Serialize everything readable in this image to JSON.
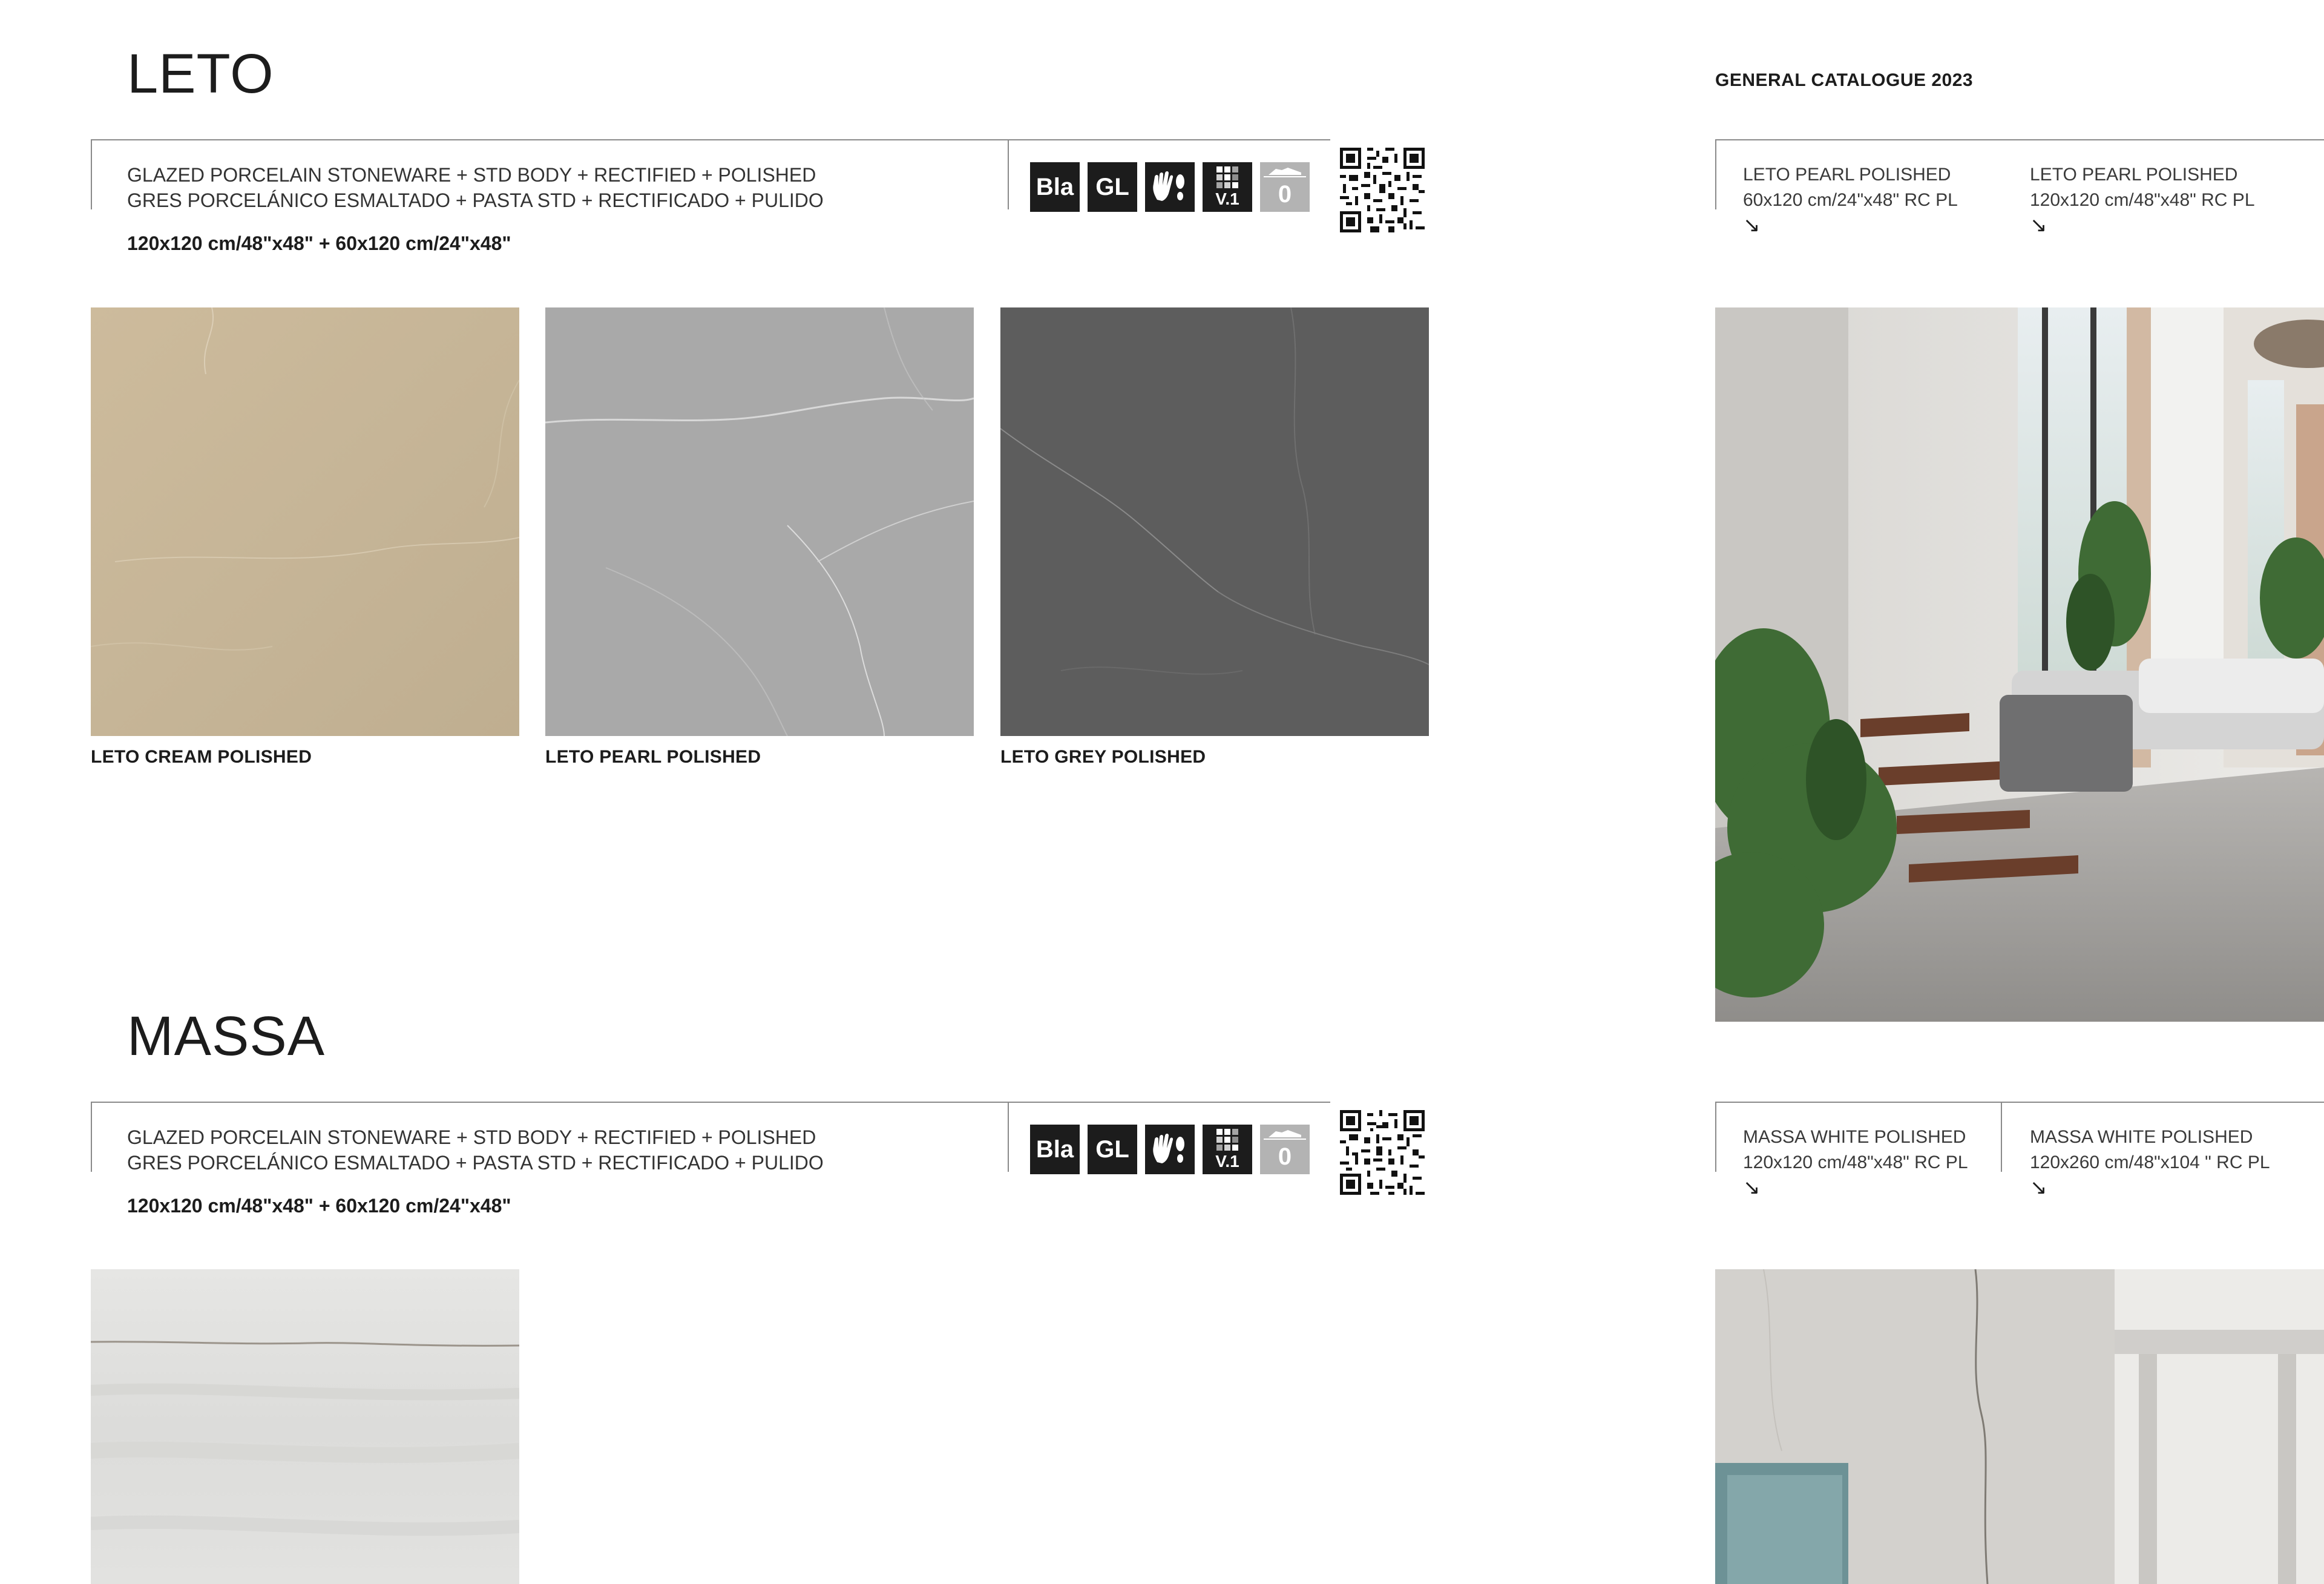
{
  "header": {
    "catalogue_label": "GENERAL CATALOGUE 2023"
  },
  "leto": {
    "title": "LETO",
    "spec_en": "GLAZED PORCELAIN STONEWARE + STD BODY + RECTIFIED + POLISHED",
    "spec_es": "GRES PORCELÁNICO ESMALTADO + PASTA STD + RECTIFICADO + PULIDO",
    "sizes": "120x120 cm/48\"x48\" + 60x120 cm/24\"x48\"",
    "icons": [
      {
        "name": "bla-icon",
        "text": "Bla"
      },
      {
        "name": "gl-icon",
        "text": "GL"
      },
      {
        "name": "hand-footprint-icon",
        "text": ""
      },
      {
        "name": "shade-variation-icon",
        "text": "V.1"
      },
      {
        "name": "slip-rating-icon",
        "text": "0"
      }
    ],
    "tiles": [
      {
        "label": "LETO CREAM POLISHED",
        "color": "#c6b598"
      },
      {
        "label": "LETO PEARL POLISHED",
        "color": "#a8a8a8"
      },
      {
        "label": "LETO GREY POLISHED",
        "color": "#5e5e5e"
      }
    ],
    "refs": [
      {
        "name": "LETO PEARL POLISHED",
        "size": "60x120 cm/24\"x48\" RC PL",
        "arrow": "↘"
      },
      {
        "name": "LETO PEARL POLISHED",
        "size": "120x120 cm/48\"x48\" RC PL",
        "arrow": "↘"
      }
    ]
  },
  "massa": {
    "title": "MASSA",
    "spec_en": "GLAZED PORCELAIN STONEWARE + STD BODY + RECTIFIED + POLISHED",
    "spec_es": "GRES PORCELÁNICO ESMALTADO + PASTA STD + RECTIFICADO + PULIDO",
    "sizes": "120x120 cm/48\"x48\" + 60x120 cm/24\"x48\"",
    "icons": [
      {
        "name": "bla-icon",
        "text": "Bla"
      },
      {
        "name": "gl-icon",
        "text": "GL"
      },
      {
        "name": "hand-footprint-icon",
        "text": ""
      },
      {
        "name": "shade-variation-icon",
        "text": "V.1"
      },
      {
        "name": "slip-rating-icon",
        "text": "0"
      }
    ],
    "tiles": [
      {
        "label": "",
        "color": "#e4e3e1"
      }
    ],
    "refs": [
      {
        "name": "MASSA WHITE POLISHED",
        "size": "120x120 cm/48\"x48\" RC PL",
        "arrow": "↘"
      },
      {
        "name": "MASSA WHITE POLISHED",
        "size": "120x260 cm/48\"x104 \" RC PL",
        "arrow": "↘"
      }
    ]
  }
}
